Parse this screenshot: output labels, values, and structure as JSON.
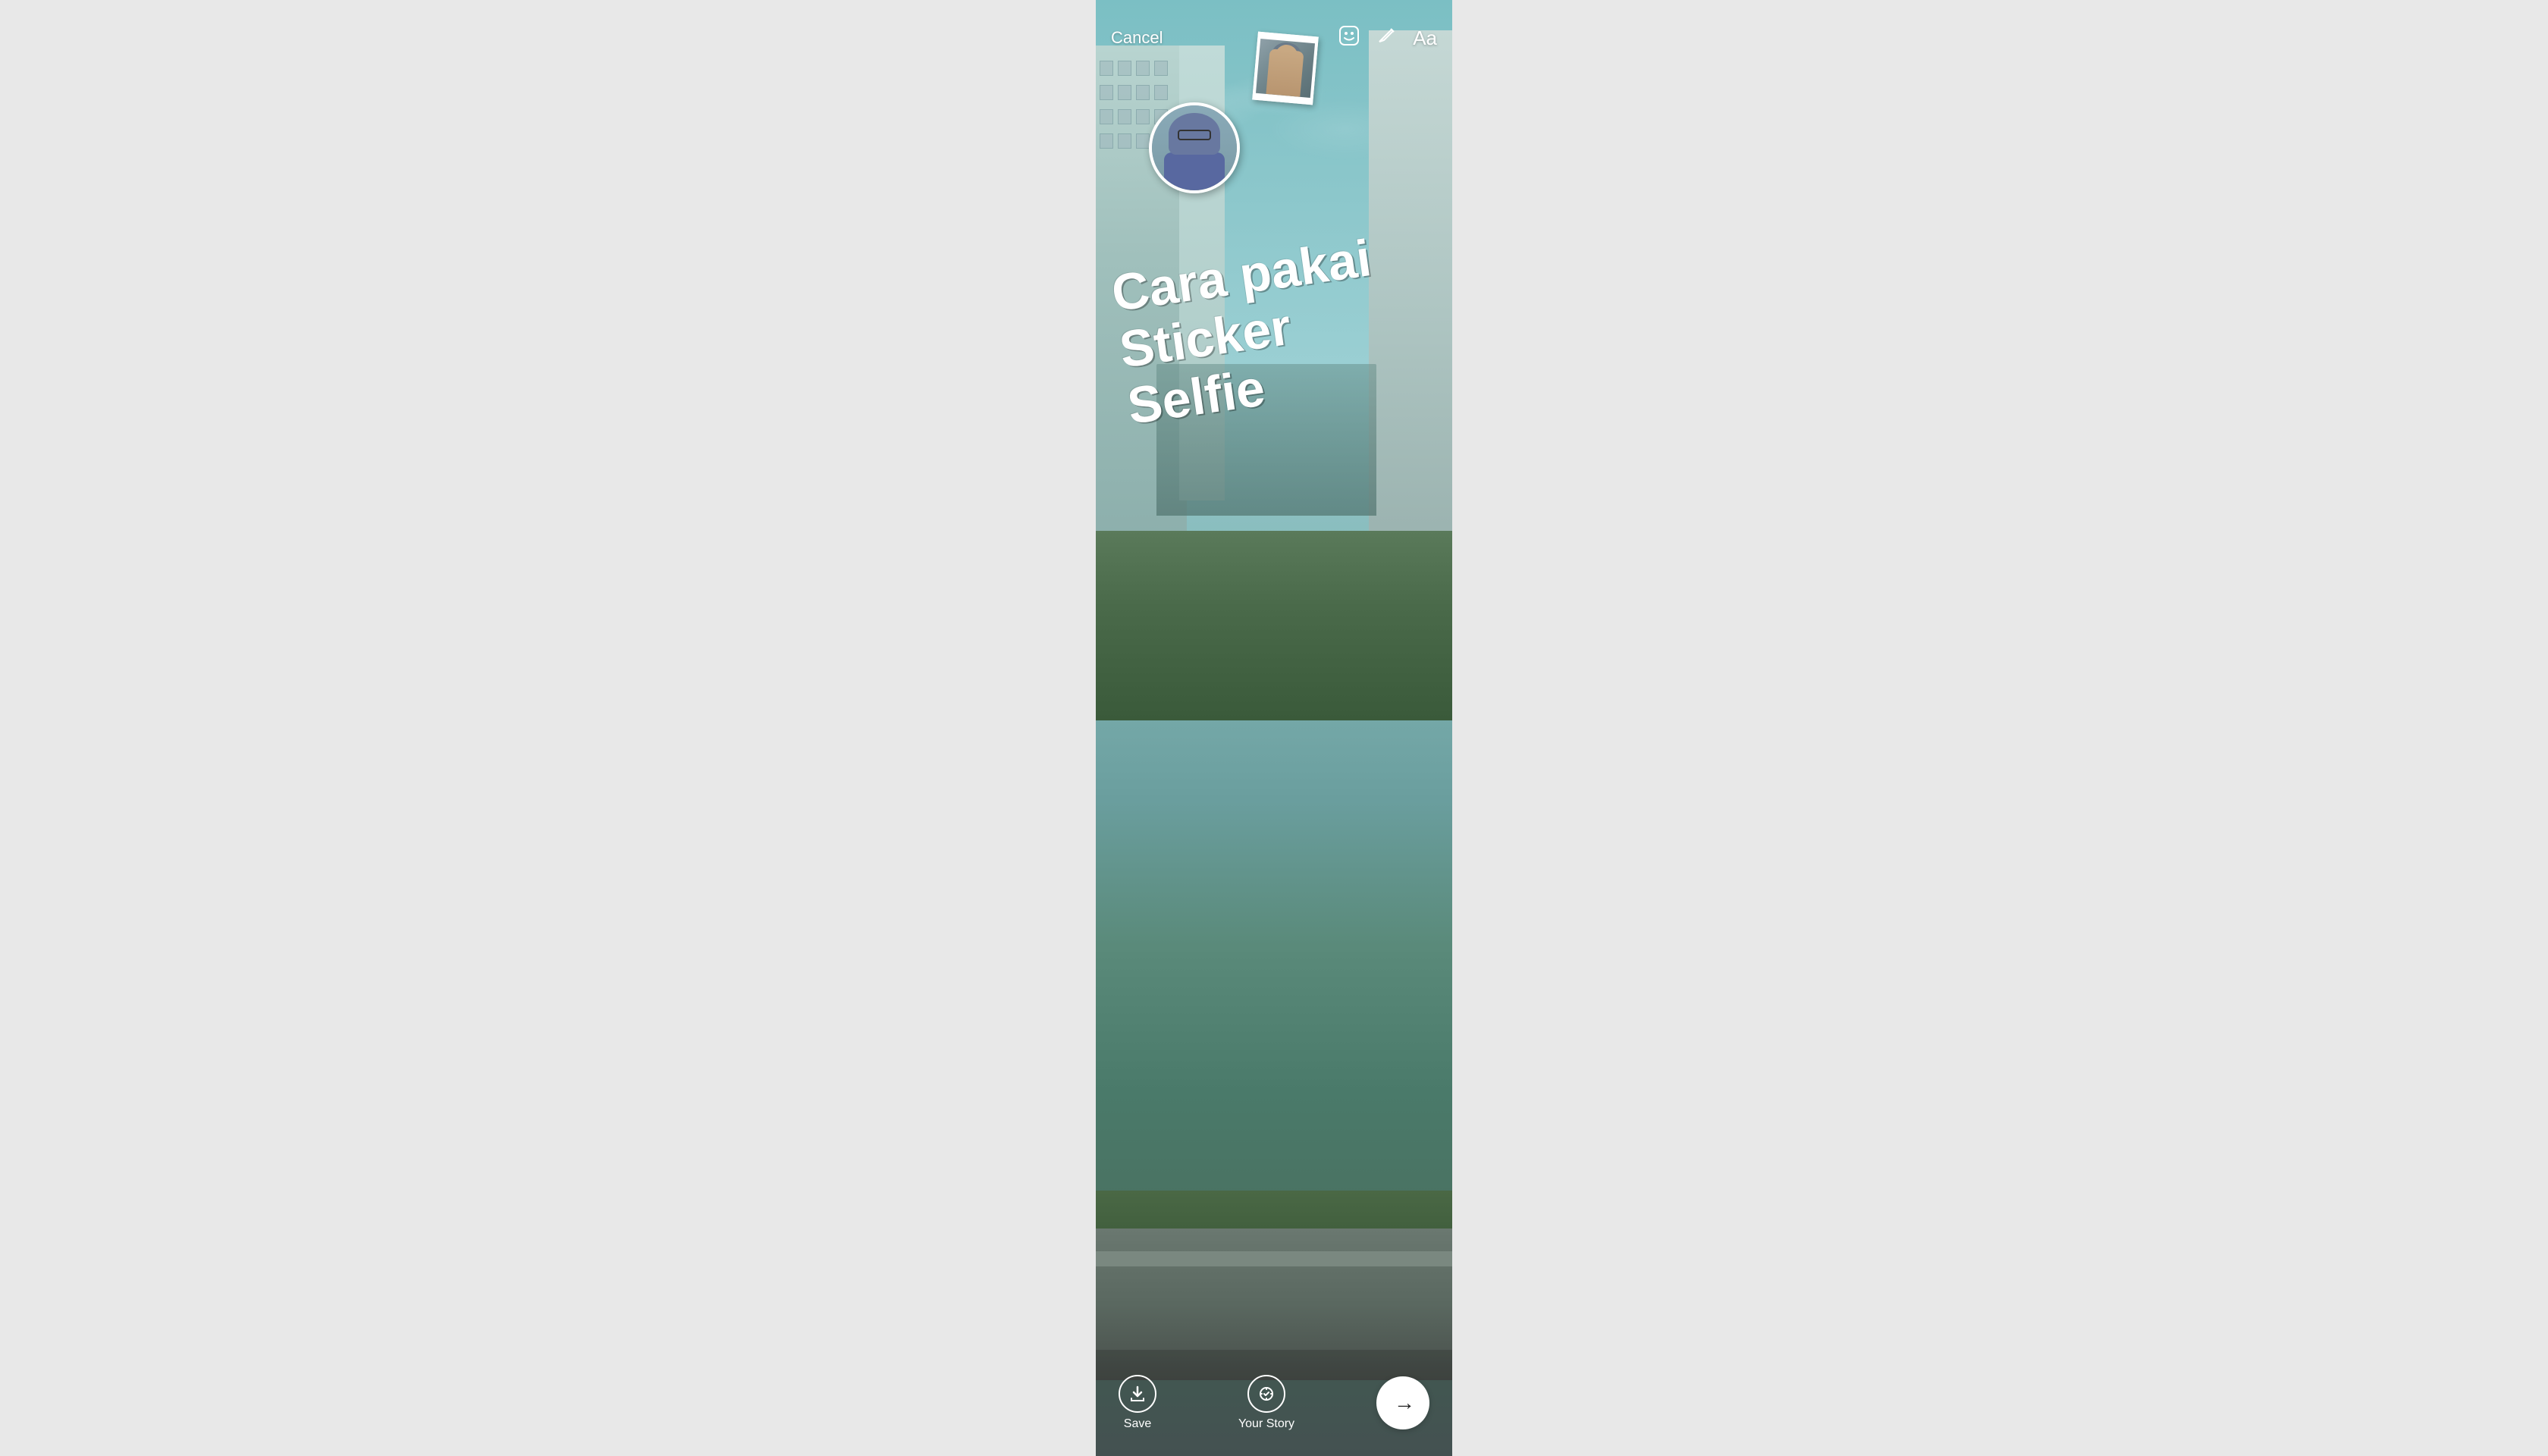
{
  "header": {
    "cancel_label": "Cancel",
    "sticker_icon": "sticker-face",
    "draw_icon": "pencil",
    "text_icon": "Aa"
  },
  "content": {
    "overlay_line1": "Cara pakai Sticker",
    "overlay_line2": "Selfie"
  },
  "bottom_bar": {
    "save_label": "Save",
    "your_story_label": "Your Story",
    "send_arrow": "→"
  }
}
